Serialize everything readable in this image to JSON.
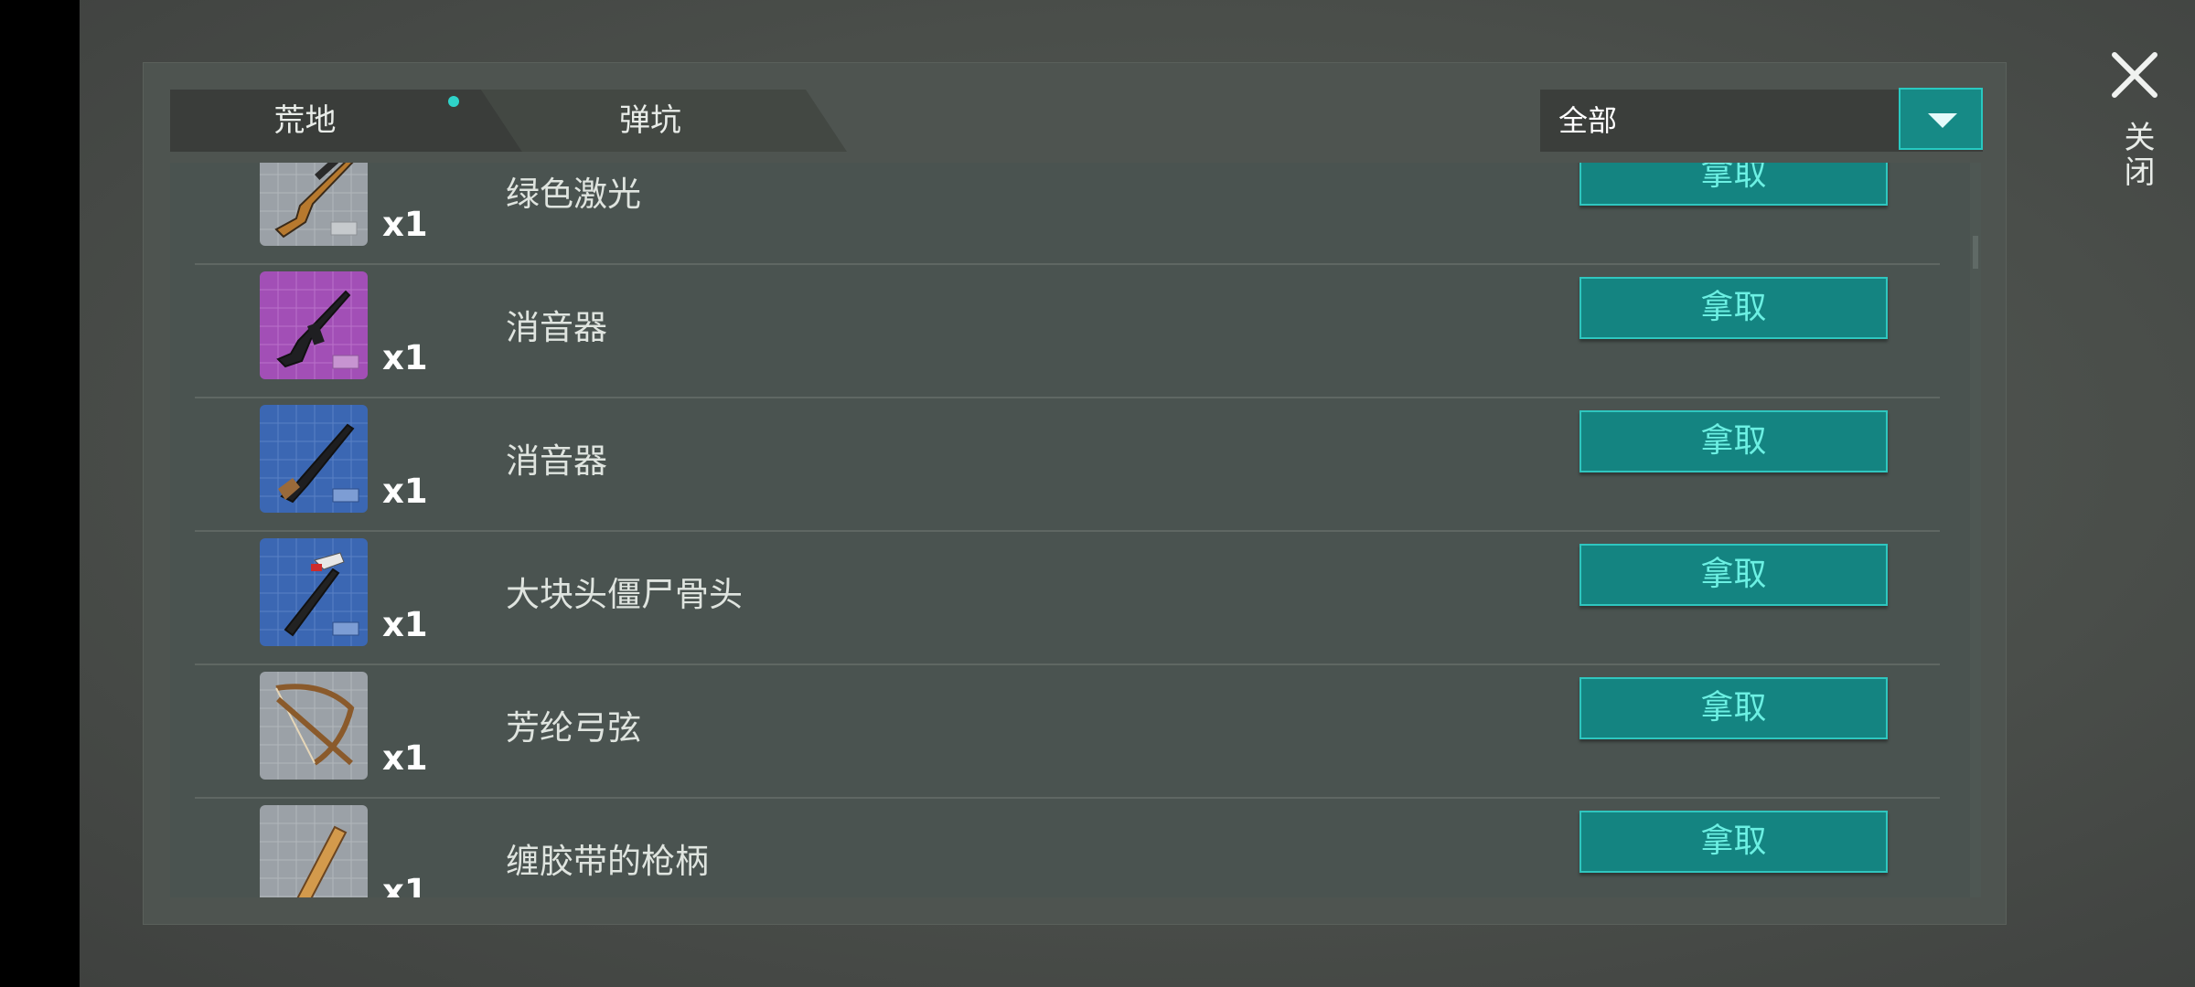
{
  "tabs": [
    {
      "label": "荒地",
      "active": true,
      "has_notification": true
    },
    {
      "label": "弹坑",
      "active": false
    }
  ],
  "filter": {
    "selected": "全部"
  },
  "close": {
    "label": "关闭"
  },
  "take_button_label": "拿取",
  "items": [
    {
      "name": "绿色激光",
      "qty": "x1",
      "icon": "sniper-rifle-blueprint-icon",
      "tile_color": "#9aa0a6"
    },
    {
      "name": "消音器",
      "qty": "x1",
      "icon": "assault-rifle-blueprint-icon",
      "tile_color": "#a050b4"
    },
    {
      "name": "消音器",
      "qty": "x1",
      "icon": "shotgun-blueprint-icon",
      "tile_color": "#3a66b2"
    },
    {
      "name": "大块头僵尸骨头",
      "qty": "x1",
      "icon": "hammer-blueprint-icon",
      "tile_color": "#3a66b2"
    },
    {
      "name": "芳纶弓弦",
      "qty": "x1",
      "icon": "crossbow-blueprint-icon",
      "tile_color": "#9aa0a6"
    },
    {
      "name": "缠胶带的枪柄",
      "qty": "x1",
      "icon": "bat-blueprint-icon",
      "tile_color": "#9aa0a6"
    }
  ]
}
